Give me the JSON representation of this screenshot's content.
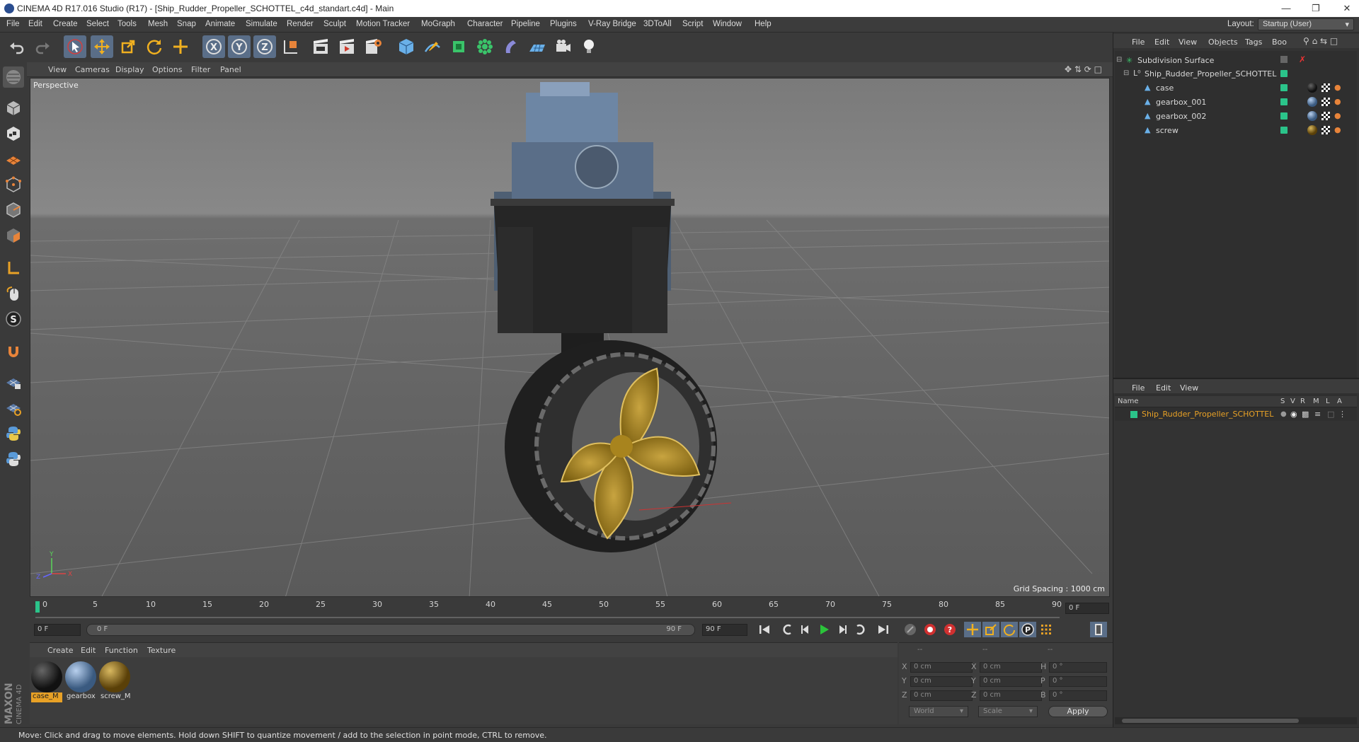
{
  "window": {
    "title": "CINEMA 4D R17.016 Studio (R17) - [Ship_Rudder_Propeller_SCHOTTEL_c4d_standart.c4d] - Main"
  },
  "menu": [
    "File",
    "Edit",
    "Create",
    "Select",
    "Tools",
    "Mesh",
    "Snap",
    "Animate",
    "Simulate",
    "Render",
    "Sculpt",
    "Motion Tracker",
    "MoGraph",
    "Character",
    "Pipeline",
    "Plugins",
    "V-Ray Bridge",
    "3DToAll",
    "Script",
    "Window",
    "Help"
  ],
  "layout": {
    "label": "Layout:",
    "value": "Startup (User)"
  },
  "viewport": {
    "menu": [
      "View",
      "Cameras",
      "Display",
      "Filter",
      "Panel",
      "Options"
    ],
    "camera_label": "Perspective",
    "grid_spacing": "Grid Spacing : 1000 cm"
  },
  "timeline": {
    "ticks": [
      "0",
      "5",
      "10",
      "15",
      "20",
      "25",
      "30",
      "35",
      "40",
      "45",
      "50",
      "55",
      "60",
      "65",
      "70",
      "75",
      "80",
      "85",
      "90"
    ],
    "current_frame": "0 F",
    "start_frame": "0 F",
    "range_start": "0 F",
    "range_end": "90 F",
    "end_frame": "90 F"
  },
  "materials": {
    "menu": [
      "Create",
      "Edit",
      "Function",
      "Texture"
    ],
    "items": [
      {
        "name": "case_M",
        "color": "#1c1c1c"
      },
      {
        "name": "gearbox",
        "color": "#5a7fa8"
      },
      {
        "name": "screw_M",
        "color": "#8a6a1a"
      }
    ]
  },
  "coordinates": {
    "headers": [
      "--",
      "--",
      "--"
    ],
    "rows": [
      {
        "l1": "X",
        "v1": "0 cm",
        "l2": "X",
        "v2": "0 cm",
        "l3": "H",
        "v3": "0 °"
      },
      {
        "l1": "Y",
        "v1": "0 cm",
        "l2": "Y",
        "v2": "0 cm",
        "l3": "P",
        "v3": "0 °"
      },
      {
        "l1": "Z",
        "v1": "0 cm",
        "l2": "Z",
        "v2": "0 cm",
        "l3": "B",
        "v3": "0 °"
      }
    ],
    "mode1": "World",
    "mode2": "Scale",
    "apply": "Apply"
  },
  "object_manager": {
    "menu": [
      "File",
      "Edit",
      "View",
      "Objects",
      "Tags",
      "Boo"
    ],
    "objects": [
      {
        "name": "Subdivision Surface",
        "depth": 0
      },
      {
        "name": "Ship_Rudder_Propeller_SCHOTTEL",
        "depth": 1
      },
      {
        "name": "case",
        "depth": 2
      },
      {
        "name": "gearbox_001",
        "depth": 2
      },
      {
        "name": "gearbox_002",
        "depth": 2
      },
      {
        "name": "screw",
        "depth": 2
      }
    ]
  },
  "attribute_manager": {
    "menu": [
      "File",
      "Edit",
      "View"
    ],
    "columns": [
      "Name",
      "S",
      "V",
      "R",
      "M",
      "L",
      "A"
    ],
    "layer_name": "Ship_Rudder_Propeller_SCHOTTEL"
  },
  "status": "Move: Click and drag to move elements. Hold down SHIFT to quantize movement / add to the selection in point mode, CTRL to remove.",
  "branding": "MAXON CINEMA 4D",
  "colors": {
    "accent": "#e8a126",
    "layer_green": "#2bc48a",
    "selected_blue": "#5a6e88"
  }
}
